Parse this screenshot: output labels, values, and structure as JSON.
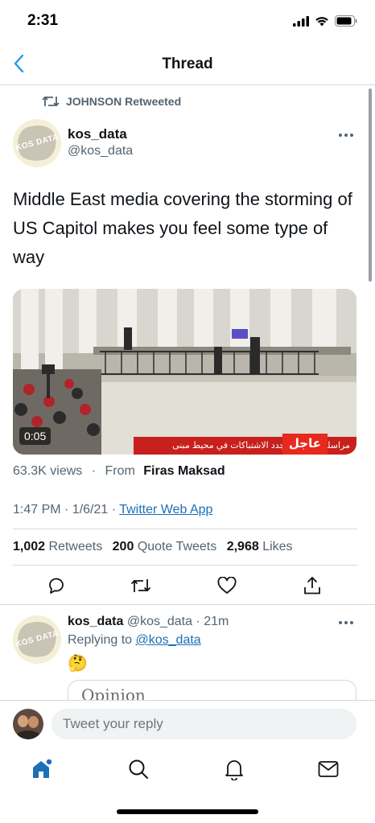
{
  "status": {
    "time": "2:31"
  },
  "header": {
    "title": "Thread"
  },
  "retweet_banner": {
    "text": "JOHNSON Retweeted"
  },
  "tweet": {
    "author_name": "kos_data",
    "author_handle": "@kos_data",
    "avatar_text": "KOS DATA",
    "text": "Middle East media covering the storming of US Capitol makes you feel some type of way",
    "video_duration": "0:05",
    "ticker_text": "مراسلة الجزيرة: تجدد الاشتباكات في محيط مبنى",
    "ticker_badge": "عاجل",
    "views": "63.3K views",
    "separator": "·",
    "from_label": "From",
    "from_name": "Firas Maksad",
    "timestamp": "1:47 PM · 1/6/21 · ",
    "client": "Twitter Web App",
    "retweets_count": "1,002",
    "retweets_label": "Retweets",
    "quotes_count": "200",
    "quotes_label": "Quote Tweets",
    "likes_count": "2,968",
    "likes_label": "Likes"
  },
  "reply": {
    "author_name": "kos_data",
    "author_handle": "@kos_data",
    "time": "· 21m",
    "replying_label": "Replying to",
    "replying_handle": "@kos_data",
    "emoji": "🤔",
    "quote_preview": "Opinion"
  },
  "composer": {
    "placeholder": "Tweet your reply"
  },
  "colors": {
    "accent": "#1d9bf0",
    "link": "#1d6fb8",
    "text_secondary": "#536471",
    "divider": "#cfd9de",
    "ticker_red": "#c8201c"
  },
  "icons": {
    "status": [
      "signal-icon",
      "wifi-icon",
      "battery-icon"
    ],
    "actions": [
      "reply-icon",
      "retweet-icon",
      "like-icon",
      "share-icon"
    ],
    "tabs": [
      "home-icon",
      "search-icon",
      "notifications-icon",
      "messages-icon"
    ]
  }
}
